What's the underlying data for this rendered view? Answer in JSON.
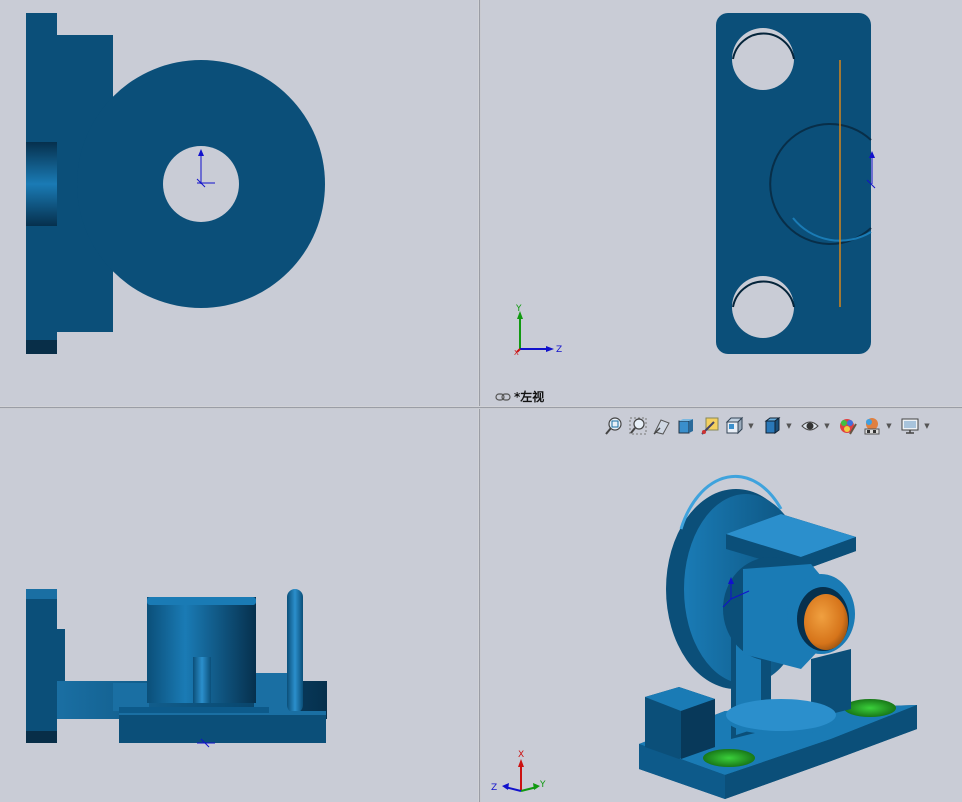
{
  "viewports": {
    "top_left": {
      "name": "front-view"
    },
    "top_right": {
      "name": "left-view",
      "label": "*左视"
    },
    "bottom_left": {
      "name": "top-view"
    },
    "bottom_right": {
      "name": "isometric-view"
    }
  },
  "triad": {
    "x": "X",
    "y": "Y",
    "z": "Z"
  },
  "toolbar": {
    "items": [
      {
        "icon": "zoom-to-fit-icon",
        "dropdown": false
      },
      {
        "icon": "zoom-to-area-icon",
        "dropdown": false
      },
      {
        "icon": "previous-view-icon",
        "dropdown": false
      },
      {
        "icon": "section-view-icon",
        "dropdown": false
      },
      {
        "icon": "dynamic-annotation-view-icon",
        "dropdown": false
      },
      {
        "icon": "view-orientation-icon",
        "dropdown": true
      },
      {
        "icon": "display-style-icon",
        "dropdown": true
      },
      {
        "icon": "hide-show-items-icon",
        "dropdown": true
      },
      {
        "icon": "edit-appearance-icon",
        "dropdown": false
      },
      {
        "icon": "apply-scene-icon",
        "dropdown": true
      },
      {
        "icon": "view-settings-icon",
        "dropdown": true
      }
    ]
  },
  "colors": {
    "background": "#c9ccd6",
    "part_body": "#0b4f79",
    "part_highlight": "#1a7bb5",
    "bore": "#d6741a",
    "hole": "#1e8a1e",
    "axis_x": "#cc1111",
    "axis_y": "#119911",
    "axis_z": "#1111cc"
  }
}
